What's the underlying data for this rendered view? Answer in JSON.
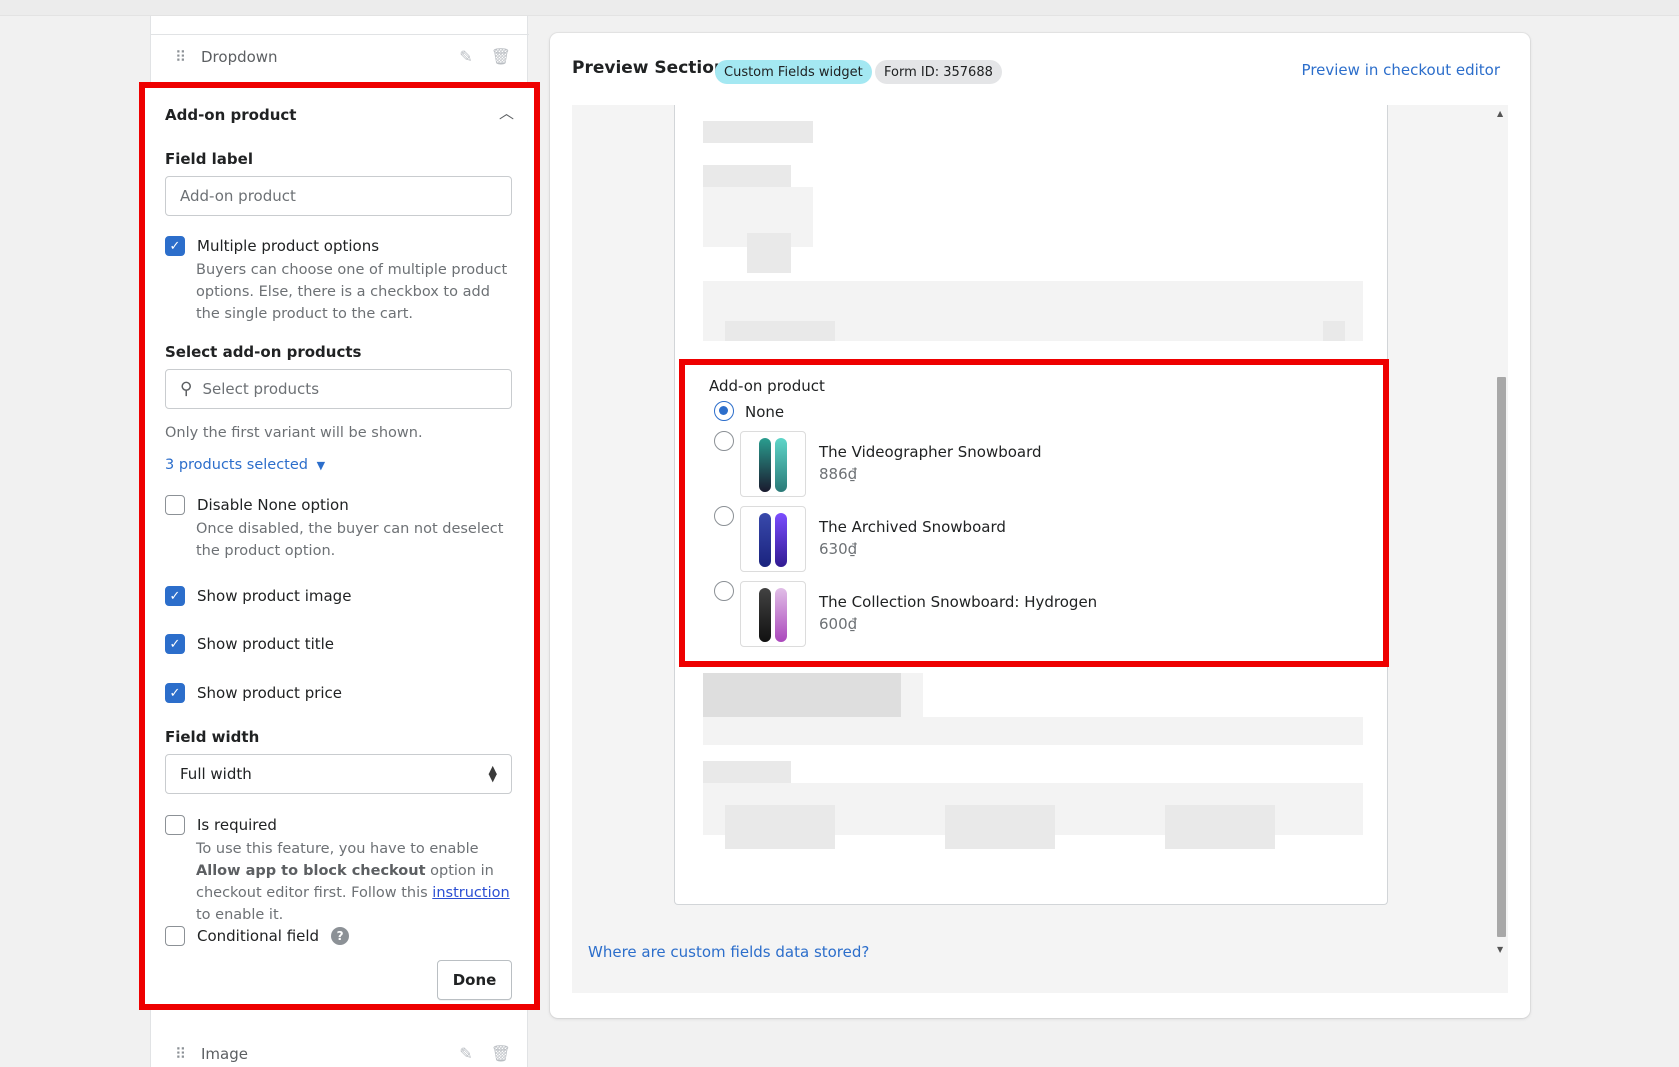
{
  "left_panel": {
    "top_field": {
      "label": "Dropdown",
      "drag_icon": "drag-handle-icon",
      "edit_icon": "pencil-icon",
      "delete_icon": "trash-icon"
    },
    "bottom_field": {
      "label": "Image"
    },
    "editor": {
      "title": "Add-on product",
      "field_label": {
        "label": "Field label",
        "placeholder": "Add-on product"
      },
      "multiple_options": {
        "label": "Multiple product options",
        "checked": true,
        "help": "Buyers can choose one of multiple product options. Else, there is a checkbox to add the single product to the cart."
      },
      "select_products": {
        "label": "Select add-on products",
        "placeholder": "Select products",
        "help": "Only the first variant will be shown.",
        "selected_link": "3 products selected"
      },
      "disable_none": {
        "label": "Disable None option",
        "checked": false,
        "help": "Once disabled, the buyer can not deselect the product option."
      },
      "show_image": {
        "label": "Show product image",
        "checked": true
      },
      "show_title": {
        "label": "Show product title",
        "checked": true
      },
      "show_price": {
        "label": "Show product price",
        "checked": true
      },
      "field_width": {
        "label": "Field width",
        "value": "Full width"
      },
      "is_required": {
        "label": "Is required",
        "checked": false,
        "help_prefix": "To use this feature, you have to enable ",
        "help_bold": "Allow app to block checkout",
        "help_mid": " option in checkout editor first. Follow this ",
        "help_link": "instruction",
        "help_suffix": " to enable it."
      },
      "conditional": {
        "label": "Conditional field",
        "checked": false,
        "help_icon": "?"
      },
      "done_label": "Done"
    }
  },
  "preview": {
    "title": "Preview Section",
    "badge_widget": "Custom Fields widget",
    "badge_form": "Form ID: 357688",
    "checkout_link": "Preview in checkout editor",
    "addon": {
      "label": "Add-on product",
      "none_label": "None",
      "products": [
        {
          "title": "The Videographer Snowboard",
          "price": "886₫"
        },
        {
          "title": "The Archived Snowboard",
          "price": "630₫"
        },
        {
          "title": "The Collection Snowboard: Hydrogen",
          "price": "600₫"
        }
      ]
    },
    "footer_link": "Where are custom fields data stored?"
  },
  "colors": {
    "accent": "#2c6ecb",
    "highlight": "#ee0000",
    "badge_teal": "#a4e8f2"
  }
}
